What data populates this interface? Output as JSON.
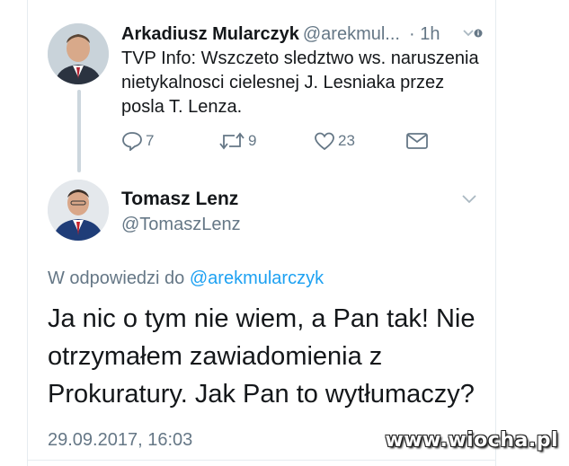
{
  "parent_tweet": {
    "name": "Arkadiusz Mularczyk",
    "handle": "@arekmul...",
    "time": "· 1h",
    "text": "TVP Info: Wszczeto sledztwo ws. naruszenia nietykalnosci cielesnej J. Lesniaka przez posla T. Lenza.",
    "replies": "7",
    "retweets": "9",
    "likes": "23"
  },
  "reply_tweet": {
    "name": "Tomasz Lenz",
    "handle": "@TomaszLenz",
    "replying_prefix": "W odpowiedzi do",
    "replying_to": "@arekmularczyk",
    "text": "Ja nic o tym nie wiem, a Pan tak! Nie otrzymałem zawiadomienia z Prokuratury. Jak Pan to wytłumaczy?",
    "date": "29.09.2017, 16:03"
  },
  "watermark": "www.wiocha.pl",
  "colors": {
    "primary_text": "#14171a",
    "secondary_text": "#657786",
    "link": "#1da1f2",
    "divider": "#e6ecf0"
  }
}
